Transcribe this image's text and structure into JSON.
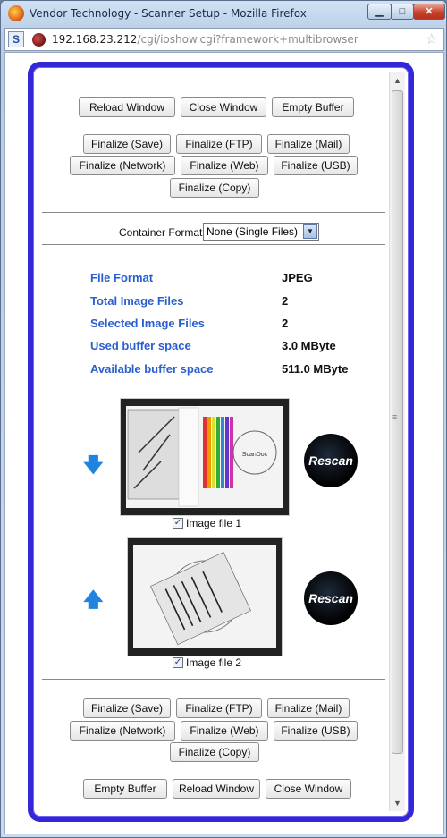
{
  "window": {
    "title": "Vendor Technology - Scanner Setup - Mozilla Firefox",
    "url_host": "192.168.23.212",
    "url_path": "/cgi/ioshow.cgi?framework+multibrowser",
    "min_glyph": "▁",
    "max_glyph": "□",
    "close_glyph": "✕"
  },
  "top_buttons": [
    "Reload Window",
    "Close Window",
    "Empty Buffer"
  ],
  "finalize_top": [
    "Finalize (Save)",
    "Finalize (FTP)",
    "Finalize (Mail)",
    "Finalize (Network)",
    "Finalize (Web)",
    "Finalize (USB)",
    "Finalize (Copy)"
  ],
  "container_format": {
    "label": "Container Format",
    "value": "None (Single Files)"
  },
  "info": [
    {
      "label": "File Format",
      "value": "JPEG"
    },
    {
      "label": "Total Image Files",
      "value": "2"
    },
    {
      "label": "Selected Image Files",
      "value": "2"
    },
    {
      "label": "Used buffer space",
      "value": "3.0 MByte"
    },
    {
      "label": "Available buffer space",
      "value": "511.0 MByte"
    }
  ],
  "images": [
    {
      "label": "Image file 1",
      "checked": true,
      "move_icon": "arrow-down",
      "rescan_label": "Rescan"
    },
    {
      "label": "Image file 2",
      "checked": true,
      "move_icon": "arrow-up",
      "rescan_label": "Rescan"
    }
  ],
  "finalize_bottom": [
    "Finalize (Save)",
    "Finalize (FTP)",
    "Finalize (Mail)",
    "Finalize (Network)",
    "Finalize (Web)",
    "Finalize (USB)",
    "Finalize (Copy)"
  ],
  "bottom_buttons": [
    "Empty Buffer",
    "Reload Window",
    "Close Window"
  ]
}
